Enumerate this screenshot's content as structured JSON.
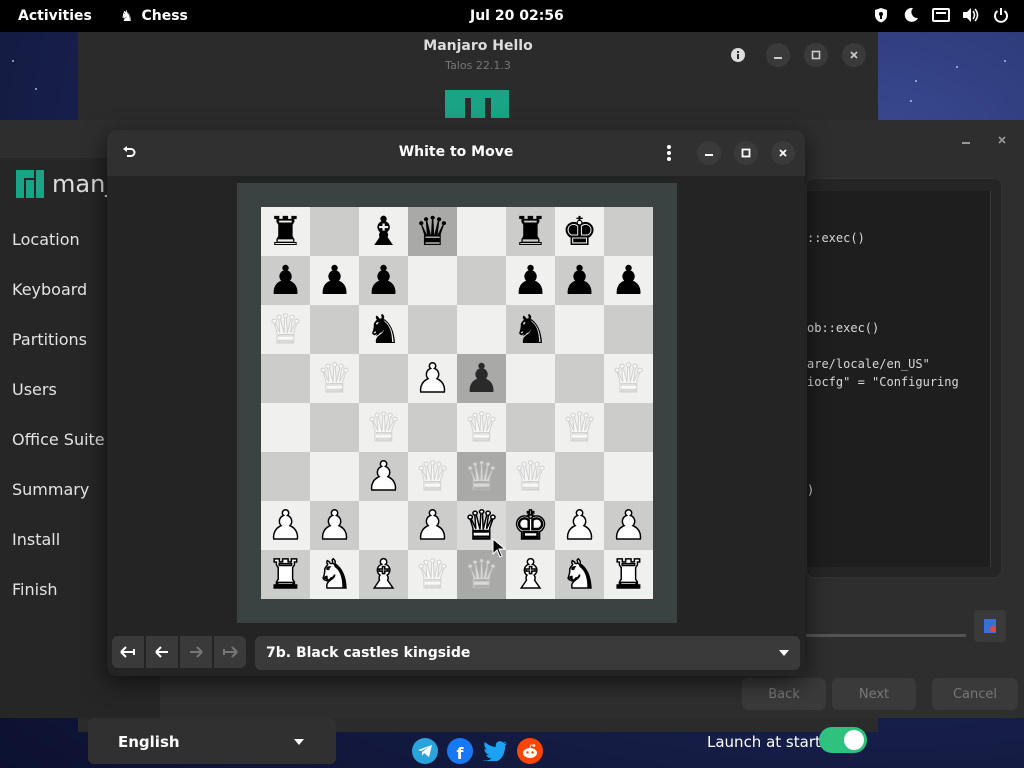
{
  "topbar": {
    "activities": "Activities",
    "app_name": "Chess",
    "app_icon": "chess-icon",
    "clock": "Jul 20  02:56",
    "tray_icons": [
      "privacy-icon",
      "night-light-icon",
      "keyboard-icon",
      "volume-icon",
      "power-icon"
    ]
  },
  "hello": {
    "title": "Manjaro Hello",
    "subtitle": "Talos 22.1.3",
    "language": "English",
    "socials": [
      "telegram-icon",
      "facebook-icon",
      "twitter-icon",
      "reddit-icon"
    ],
    "launch_label": "Launch at start",
    "launch_enabled": true
  },
  "installer": {
    "logo_text": "manja",
    "sidebar": [
      "Location",
      "Keyboard",
      "Partitions",
      "Users",
      "Office Suite",
      "Summary",
      "Install",
      "Finish"
    ],
    "log_lines": [
      "::exec()",
      "ob::exec()",
      "are/locale/en_US\"",
      "iocfg\" = \"Configuring",
      ")"
    ],
    "buttons": {
      "back": "Back",
      "next": "Next",
      "cancel": "Cancel"
    }
  },
  "chess": {
    "title": "White to Move",
    "move": "7b. Black castles kingside",
    "board": [
      [
        "bR",
        "",
        "bB",
        "bQ",
        "",
        "bR",
        "bK",
        ""
      ],
      [
        "bP",
        "bP",
        "bP",
        "",
        "",
        "bP",
        "bP",
        "bP"
      ],
      [
        "gQ",
        "",
        "bN",
        "",
        "",
        "bN",
        "",
        ""
      ],
      [
        "",
        "gQ",
        "",
        "wP",
        "bPg",
        "",
        "",
        "gQ"
      ],
      [
        "",
        "",
        "gQ",
        "",
        "gQ",
        "",
        "gQ",
        ""
      ],
      [
        "",
        "",
        "wP",
        "gQ",
        "gQ",
        "gQ",
        "",
        ""
      ],
      [
        "wP",
        "wP",
        "",
        "wP",
        "wQ",
        "wK",
        "wP",
        "wP"
      ],
      [
        "wR",
        "wN",
        "wB",
        "gQ",
        "gQ",
        "wB",
        "wN",
        "wR"
      ]
    ],
    "highlight": [
      [
        0,
        3
      ],
      [
        3,
        4
      ],
      [
        5,
        4
      ],
      [
        6,
        4
      ],
      [
        7,
        4
      ]
    ]
  }
}
